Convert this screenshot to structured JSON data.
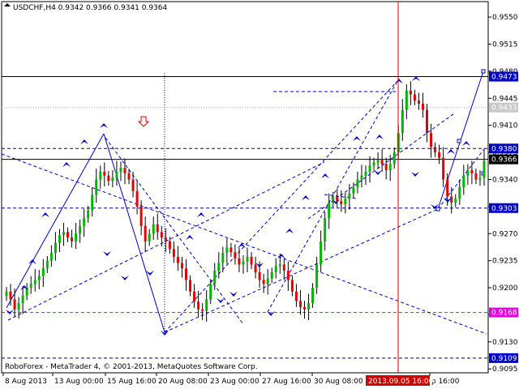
{
  "window": {
    "header": "USDCHF,H4  0.9342 0.9366 0.9341 0.9364",
    "footer": "RoboForex - MetaTrader 4, © 2001-2013, MetaQuotes Software Corp."
  },
  "colors": {
    "up_candle": "#00b400",
    "down_candle": "#e00000",
    "wick": "#000000",
    "pattern_line": "#0000c8",
    "magenta_level": "#e000e0",
    "red_marker_line": "#d00000",
    "price_tag_blue": "#0000c8",
    "price_tag_gray": "#c8c8c8",
    "price_tag_magenta": "#e000e0",
    "red_marker_tag": "#d00000"
  },
  "icons": {
    "wave_marker": "blue-arrow-icon",
    "signal": "red-down-arrow-icon"
  },
  "chart_data": {
    "type": "candlestick",
    "symbol": "USDCHF",
    "timeframe": "H4",
    "ohlc_current": {
      "open": 0.9342,
      "high": 0.9366,
      "low": 0.9341,
      "close": 0.9364
    },
    "ylim": [
      0.909,
      0.957
    ],
    "y_ticks": [
      "0.9550",
      "0.9515",
      "0.9480",
      "0.9445",
      "0.9410",
      "0.9375",
      "0.9340",
      "0.9305",
      "0.9270",
      "0.9235",
      "0.9200",
      "0.9165",
      "0.9130",
      "0.9095"
    ],
    "x_ticks": [
      "8 Aug 2013",
      "13 Aug 00:00",
      "15 Aug 16:00",
      "20 Aug 08:00",
      "23 Aug 00:00",
      "27 Aug 16:00",
      "30 Aug 08:00",
      "2013.09.05 16:00",
      "p 16:00"
    ],
    "levels": [
      {
        "label": "0.9473",
        "value": 0.9473,
        "style": "solid",
        "tag": "blue"
      },
      {
        "label": "0.9433",
        "value": 0.9433,
        "style": "dotted",
        "tag": "gray"
      },
      {
        "label": "0.9380",
        "value": 0.938,
        "style": "dashed",
        "tag": "blue"
      },
      {
        "label": "0.9366",
        "value": 0.9366,
        "style": "solid",
        "tag": "blue"
      },
      {
        "label": "0.9303",
        "value": 0.9303,
        "style": "dashed",
        "tag": "blue"
      },
      {
        "label": "0.9168",
        "value": 0.9168,
        "style": "dashed",
        "tag": "magenta"
      },
      {
        "label": "0.9109",
        "value": 0.9109,
        "style": "dashed",
        "tag": "blue"
      }
    ],
    "vertical_marker": {
      "label": "2013.09.05 16:00"
    },
    "close_path": [
      0.9195,
      0.9185,
      0.9172,
      0.918,
      0.919,
      0.92,
      0.9205,
      0.921,
      0.9215,
      0.9225,
      0.9235,
      0.9245,
      0.9258,
      0.9268,
      0.9272,
      0.9265,
      0.926,
      0.927,
      0.928,
      0.929,
      0.93,
      0.932,
      0.934,
      0.935,
      0.9345,
      0.9338,
      0.9342,
      0.935,
      0.9355,
      0.9348,
      0.934,
      0.9325,
      0.9305,
      0.928,
      0.926,
      0.927,
      0.9282,
      0.9272,
      0.9265,
      0.926,
      0.925,
      0.924,
      0.9232,
      0.9225,
      0.921,
      0.9195,
      0.9182,
      0.9172,
      0.917,
      0.9185,
      0.9205,
      0.9222,
      0.9232,
      0.9245,
      0.9252,
      0.9246,
      0.9238,
      0.923,
      0.9234,
      0.924,
      0.923,
      0.922,
      0.921,
      0.9205,
      0.9212,
      0.922,
      0.9228,
      0.923,
      0.9222,
      0.921,
      0.9195,
      0.9183,
      0.9175,
      0.9172,
      0.918,
      0.92,
      0.923,
      0.926,
      0.929,
      0.931,
      0.9318,
      0.9312,
      0.9308,
      0.9315,
      0.9322,
      0.933,
      0.934,
      0.9345,
      0.935,
      0.9358,
      0.9362,
      0.9365,
      0.936,
      0.9352,
      0.936,
      0.9375,
      0.94,
      0.943,
      0.9455,
      0.945,
      0.9442,
      0.9438,
      0.943,
      0.94,
      0.9382,
      0.9375,
      0.9368,
      0.934,
      0.9318,
      0.931,
      0.9315,
      0.933,
      0.9345,
      0.9352,
      0.9348,
      0.934,
      0.9342,
      0.9364
    ]
  }
}
